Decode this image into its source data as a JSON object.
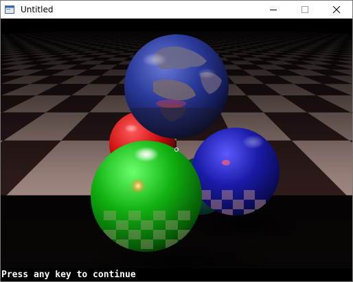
{
  "window": {
    "title": "Untitled",
    "icon": "app-window-icon",
    "controls": {
      "minimize_icon": "minimize-icon",
      "maximize_icon": "maximize-icon",
      "close_icon": "close-icon"
    }
  },
  "scene": {
    "floor": "checkerboard-marble-floor",
    "spheres": [
      {
        "name": "earth-globe-sphere",
        "color": "#2a3a9a"
      },
      {
        "name": "red-sphere",
        "color": "#d01010"
      },
      {
        "name": "blue-sphere",
        "color": "#1a1aa8"
      },
      {
        "name": "green-sphere",
        "color": "#10b010"
      },
      {
        "name": "dark-teal-sphere",
        "color": "#0a3a3a"
      }
    ]
  },
  "console": {
    "message": "Press any key to continue"
  }
}
